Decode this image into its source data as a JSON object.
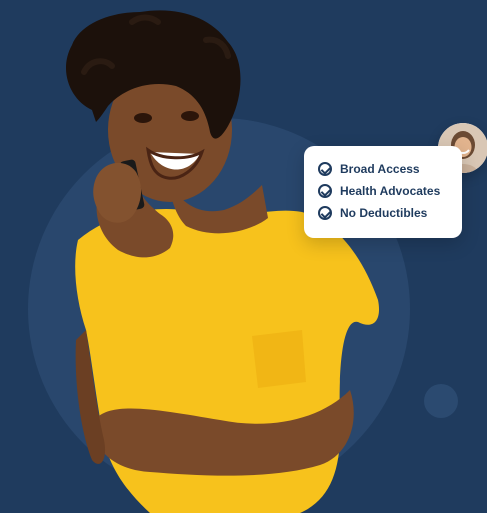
{
  "card": {
    "items": [
      {
        "label": "Broad Access",
        "icon": "check-circle-icon"
      },
      {
        "label": "Health Advocates",
        "icon": "check-circle-icon"
      },
      {
        "label": "No Deductibles",
        "icon": "check-circle-icon"
      }
    ]
  },
  "colors": {
    "background": "#1f3b5e",
    "circle": "#2b4a70",
    "shirt": "#f7c21c",
    "skin": "#7a4a2a",
    "text": "#1f3b5e"
  }
}
